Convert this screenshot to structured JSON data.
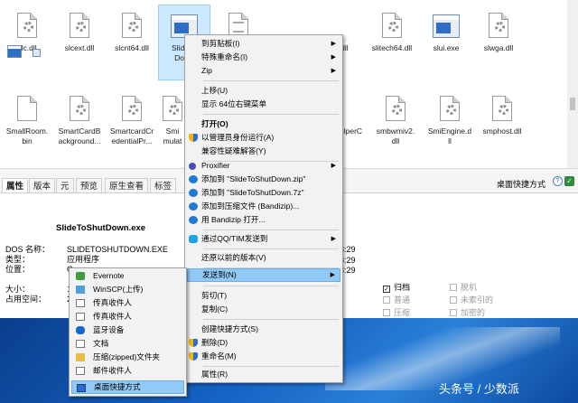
{
  "files": [
    {
      "label": "slc.dll",
      "icon": "dll-gear-icon",
      "name": "file-slc"
    },
    {
      "label": "slcext.dll",
      "icon": "dll-gear-icon",
      "name": "file-slcext"
    },
    {
      "label": "slcnt64.dll",
      "icon": "dll-gear-icon",
      "name": "file-slcnt64"
    },
    {
      "label": "SlideTo",
      "label2": "Down",
      "icon": "exe-icon",
      "name": "file-slidetoshutdown",
      "selected": true
    },
    {
      "label": "",
      "icon": "system-file-icon",
      "name": "file-hidden"
    },
    {
      "label": "0.dll",
      "icon": "dll-gear-icon",
      "name": "file-partial-0"
    },
    {
      "label": "slitech64.dll",
      "icon": "dll-gear-icon",
      "name": "file-sltech64"
    },
    {
      "label": "slui.exe",
      "icon": "exe-icon",
      "name": "file-slui"
    },
    {
      "label": "slwga.dll",
      "icon": "dll-gear-icon",
      "name": "file-slwga"
    },
    {
      "label": "SmallRoom.",
      "label2": "bin",
      "icon": "blank-file-icon",
      "name": "file-smallroom"
    },
    {
      "label": "SmartCardB",
      "label2": "ackground...",
      "icon": "dll-gear-icon",
      "name": "file-smartcardbackground"
    },
    {
      "label": "SmartcardCr",
      "label2": "edentialPr...",
      "icon": "dll-gear-icon",
      "name": "file-smartcardcredential"
    },
    {
      "label": "Smi",
      "label2": "mulat",
      "icon": "dll-gear-icon",
      "name": "file-smi-partial"
    },
    {
      "label": "elperC",
      "label2": "s",
      "icon": "dll-gear-icon",
      "name": "file-helper-partial"
    },
    {
      "label": "smbwmiv2.",
      "label2": "dll",
      "icon": "dll-gear-icon",
      "name": "file-smbwmiv2"
    },
    {
      "label": "SmiEngine.d",
      "label2": "ll",
      "icon": "dll-gear-icon",
      "name": "file-smiengine"
    },
    {
      "label": "smphost.dll",
      "icon": "dll-gear-icon",
      "name": "file-smphost"
    }
  ],
  "pane": {
    "tabs": [
      "属性",
      "版本",
      "元",
      "预览",
      "原生查看",
      "标签"
    ],
    "filename": "桌面快捷方式",
    "title": "SlideToShutDown.exe",
    "props": [
      {
        "key": "DOS 名称：",
        "value": "SLIDETOSHUTDOWN.EXE"
      },
      {
        "key": "类型：",
        "value": "应用程序"
      },
      {
        "key": "位置：",
        "value": "C"
      },
      {
        "key": "大小：",
        "value": "1"
      },
      {
        "key": "占用空间：",
        "value": "2"
      }
    ],
    "times": [
      "8:29",
      "8:29",
      "8:29"
    ],
    "attributes": [
      {
        "label": "归档",
        "checked": true
      },
      {
        "label": "普通",
        "checked": false
      },
      {
        "label": "压缩",
        "checked": false
      },
      {
        "label": "脱机",
        "checked": false
      },
      {
        "label": "未索引的",
        "checked": false
      },
      {
        "label": "加密的",
        "checked": false
      }
    ]
  },
  "context_menu": {
    "items": [
      {
        "label": "到剪贴板(I)",
        "arrow": true
      },
      {
        "label": "特殊重命名(I)",
        "arrow": true
      },
      {
        "label": "Zip",
        "arrow": true
      },
      {
        "sep": true
      },
      {
        "label": "上移(U)"
      },
      {
        "label": "显示 64位右键菜单"
      },
      {
        "sep": true
      },
      {
        "label": "打开(O)",
        "bold": true
      },
      {
        "label": "以管理员身份运行(A)",
        "icon": "shield-icon"
      },
      {
        "label": "兼容性疑难解答(Y)"
      },
      {
        "sep": true
      },
      {
        "label": "Proxifier",
        "arrow": true,
        "icon": "proxifier-icon"
      },
      {
        "label": "添加到 \"SlideToShutDown.zip\"",
        "icon": "bandizip-icon"
      },
      {
        "label": "添加到 \"SlideToShutDown.7z\"",
        "icon": "bandizip-icon"
      },
      {
        "label": "添加到压缩文件 (Bandizip)...",
        "icon": "bandizip-icon"
      },
      {
        "label": "用 Bandizip 打开...",
        "icon": "bandizip-icon"
      },
      {
        "sep": true
      },
      {
        "label": "通过QQ/TIM发送到",
        "arrow": true,
        "icon": "qq-icon"
      },
      {
        "sep": true
      },
      {
        "label": "还原以前的版本(V)"
      },
      {
        "sep": true
      },
      {
        "label": "发送到(N)",
        "arrow": true,
        "highlighted": true
      },
      {
        "sep": true
      },
      {
        "label": "剪切(T)"
      },
      {
        "label": "复制(C)"
      },
      {
        "sep": true
      },
      {
        "label": "创建快捷方式(S)"
      },
      {
        "label": "删除(D)",
        "icon": "shield-icon"
      },
      {
        "label": "重命名(M)",
        "icon": "shield-icon"
      },
      {
        "sep": true
      },
      {
        "label": "属性(R)"
      }
    ]
  },
  "sendto_menu": {
    "items": [
      {
        "label": "Evernote",
        "icon": "evernote-icon"
      },
      {
        "label": "WinSCP(上传)",
        "icon": "winscp-icon"
      },
      {
        "label": "传真收件人",
        "icon": "document-icon"
      },
      {
        "label": "传真收件人",
        "icon": "document-icon"
      },
      {
        "label": "蓝牙设备",
        "icon": "bluetooth-icon"
      },
      {
        "label": "文档",
        "icon": "document-icon"
      },
      {
        "label": "压缩(zipped)文件夹",
        "icon": "zip-folder-icon"
      },
      {
        "label": "邮件收件人",
        "icon": "mail-icon"
      },
      {
        "label": "桌面快捷方式",
        "icon": "desktop-icon",
        "highlighted": true
      }
    ]
  },
  "watermark": "头条号 / 少数派"
}
